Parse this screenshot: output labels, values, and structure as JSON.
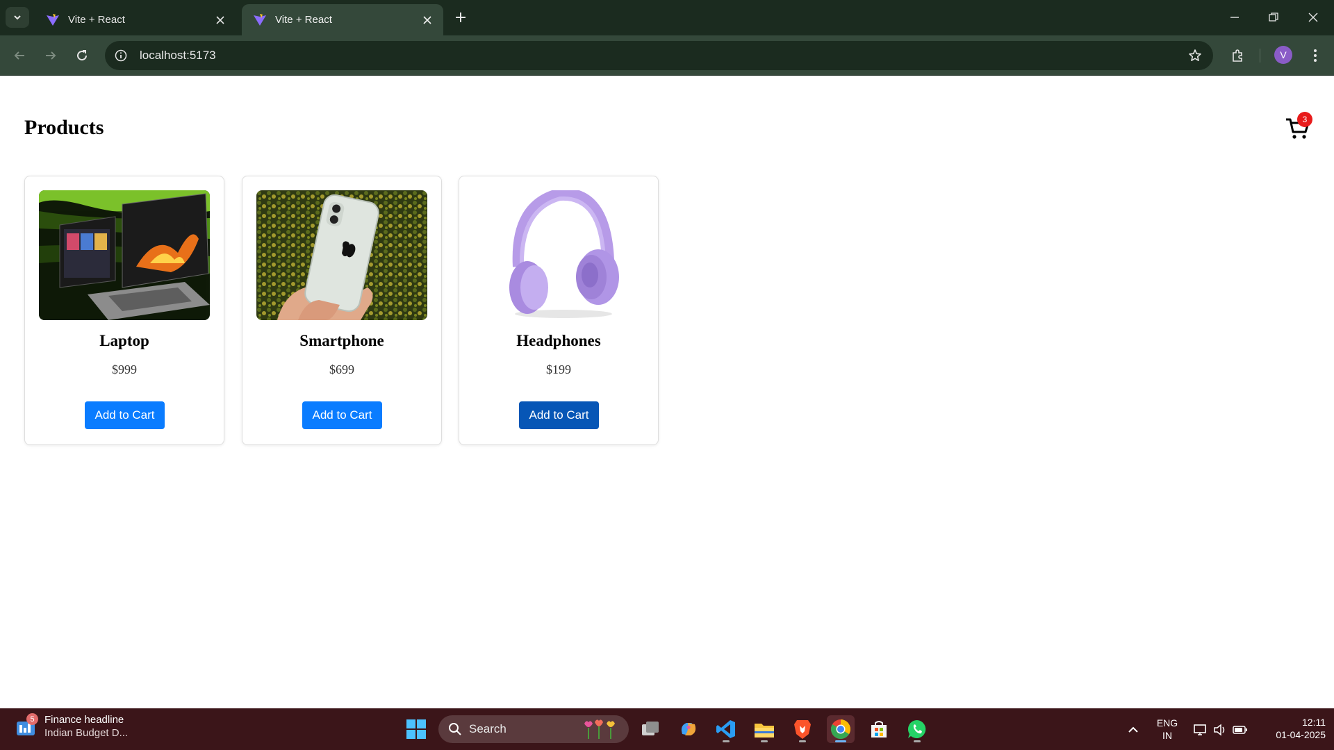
{
  "browser": {
    "tabs": [
      {
        "title": "Vite + React",
        "active": false
      },
      {
        "title": "Vite + React",
        "active": true
      }
    ],
    "url": "localhost:5173",
    "profile_initial": "V"
  },
  "page": {
    "title": "Products",
    "cart_count": "3",
    "products": [
      {
        "name": "Laptop",
        "price": "$999",
        "button": "Add to Cart"
      },
      {
        "name": "Smartphone",
        "price": "$699",
        "button": "Add to Cart"
      },
      {
        "name": "Headphones",
        "price": "$199",
        "button": "Add to Cart"
      }
    ]
  },
  "taskbar": {
    "news": {
      "badge": "5",
      "headline": "Finance headline",
      "snippet": "Indian Budget D..."
    },
    "search_label": "Search",
    "language": {
      "line1": "ENG",
      "line2": "IN"
    },
    "clock": {
      "time": "12:11",
      "date": "01-04-2025"
    }
  },
  "colors": {
    "accent_button": "#0a7cff",
    "button_hover": "#0756b6",
    "cart_badge": "#e81b1b",
    "taskbar_bg": "#3b1519",
    "chrome_bg": "#1b2b1f"
  }
}
